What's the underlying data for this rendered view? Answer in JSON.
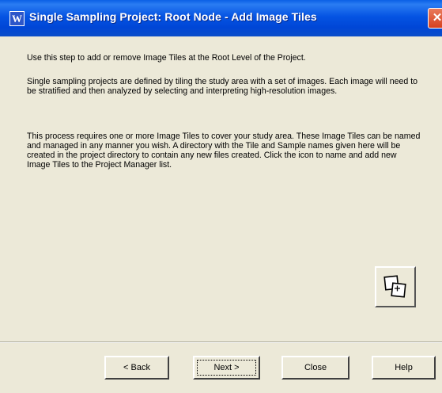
{
  "window": {
    "title": "Single Sampling Project: Root Node - Add Image Tiles",
    "icon": "app-icon",
    "close_glyph": "✕"
  },
  "content": {
    "paragraphs": [
      "Use this step to add or remove Image Tiles at the Root Level of the Project.",
      "Single sampling projects are defined by tiling the study area with a set of images. Each image will need to be stratified and then analyzed by selecting and interpreting high-resolution images.",
      "This process requires one or more Image Tiles to cover your study area. These Image Tiles can be named and managed in any manner you wish. A directory with the Tile and Sample names given here will be created in the project directory to contain any new files created. Click the icon to name and add new Image Tiles to the Project Manager list."
    ],
    "add_tiles_icon": "add-image-tiles-icon"
  },
  "buttons": {
    "back": "< Back",
    "next": "Next >",
    "close": "Close",
    "help": "Help"
  }
}
